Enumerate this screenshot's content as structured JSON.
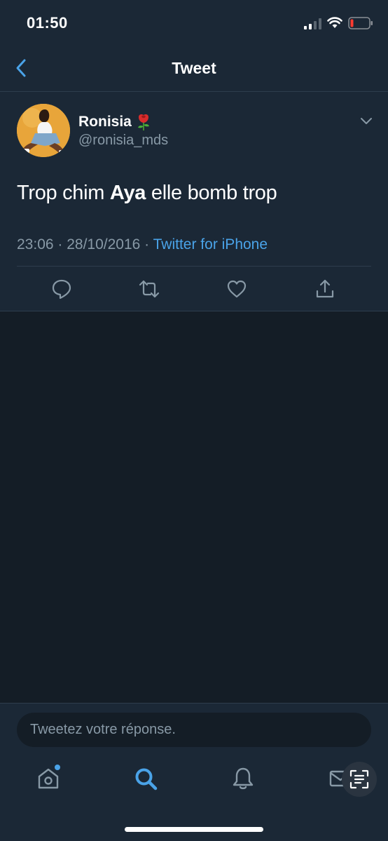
{
  "status_bar": {
    "time": "01:50"
  },
  "header": {
    "title": "Tweet"
  },
  "tweet": {
    "display_name": "Ronisia",
    "handle": "@ronisia_mds",
    "text_before": "Trop chim ",
    "text_bold": "Aya",
    "text_after": " elle bomb trop",
    "timestamp": "23:06 · 28/10/2016",
    "separator": " · ",
    "source": "Twitter for iPhone"
  },
  "reply": {
    "placeholder": "Tweetez votre réponse."
  },
  "icons": {
    "back": "chevron-left-icon",
    "caret": "chevron-down-icon",
    "reply": "reply-icon",
    "retweet": "retweet-icon",
    "like": "heart-icon",
    "share": "share-icon",
    "home": "home-icon",
    "search": "search-icon",
    "notifications": "bell-icon",
    "messages": "mail-icon",
    "scan": "text-scan-icon"
  },
  "colors": {
    "background": "#141d26",
    "surface": "#1b2836",
    "accent": "#4aa3e8",
    "secondary_text": "#8899a6",
    "divider": "#2e3d4d"
  }
}
